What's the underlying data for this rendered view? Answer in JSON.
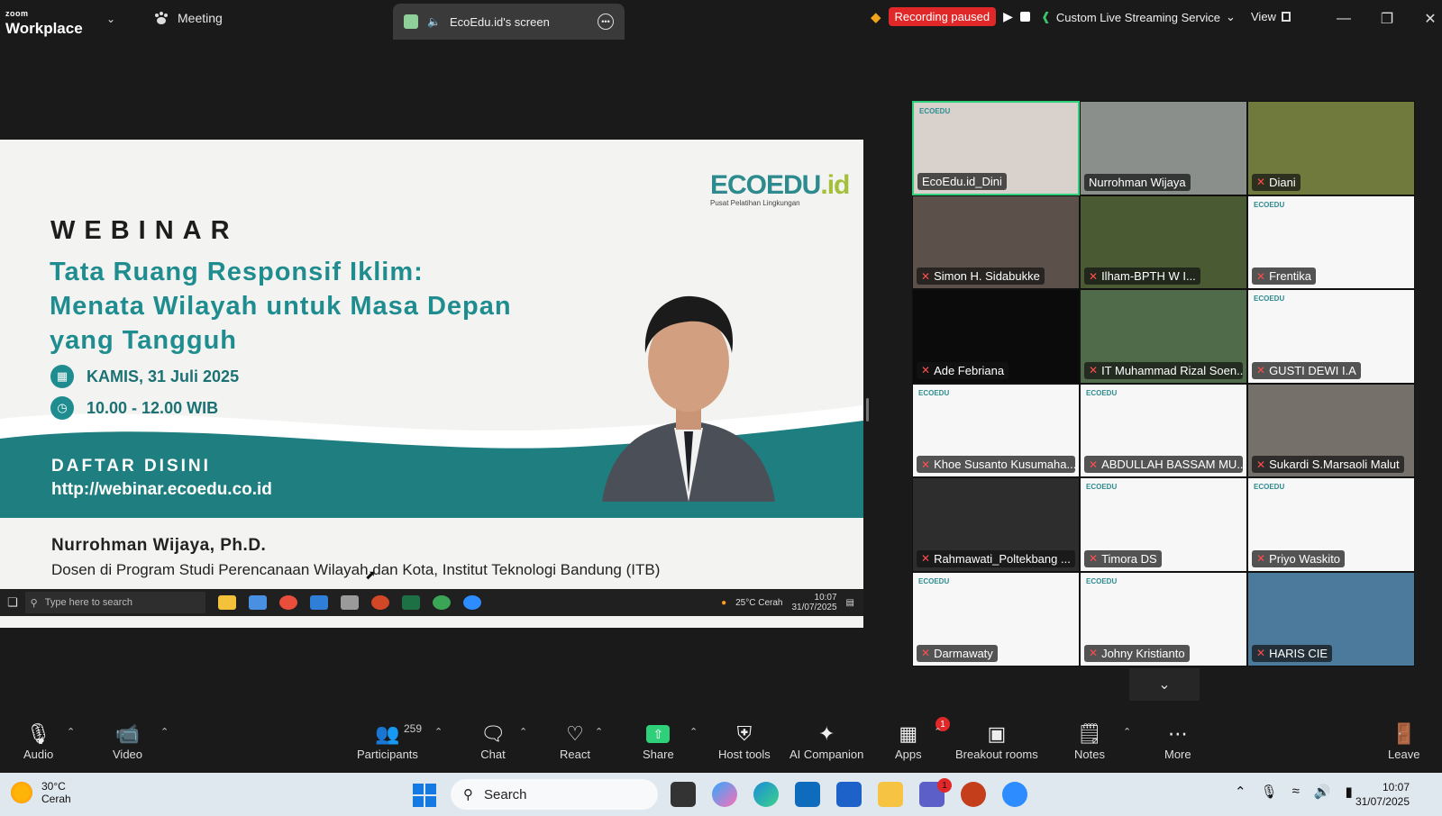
{
  "topbar": {
    "logo_small": "zoom",
    "logo_big": "Workplace",
    "meeting_label": "Meeting",
    "share_tab_title": "EcoEdu.id's screen",
    "recording_status": "Recording paused",
    "stream_label": "Custom Live Streaming Service",
    "view_label": "View"
  },
  "slide": {
    "brand": "ECOEDU",
    "brand_suffix": ".id",
    "brand_sub": "Pusat Pelatihan Lingkungan",
    "kicker": "WEBINAR",
    "title_lines": [
      "Tata Ruang Responsif Iklim:",
      "Menata Wilayah untuk Masa Depan",
      "yang Tangguh"
    ],
    "date": "KAMIS, 31 Juli 2025",
    "time": "10.00 - 12.00 WIB",
    "register_label": "DAFTAR DISINI",
    "register_url": "http://webinar.ecoedu.co.id",
    "speaker_name": "Nurrohman Wijaya, Ph.D.",
    "speaker_role": "Dosen di Program Studi Perencanaan Wilayah dan Kota, Institut Teknologi Bandung (ITB)"
  },
  "shared_taskbar": {
    "search_placeholder": "Type here to search",
    "weather": "25°C Cerah",
    "time": "10:07",
    "date": "31/07/2025"
  },
  "gallery": [
    {
      "name": "EcoEdu.id_Dini",
      "muted": false,
      "bg": "#d9d2cc",
      "active": true
    },
    {
      "name": "Nurrohman Wijaya",
      "muted": false,
      "bg": "#8a8f8c"
    },
    {
      "name": "Diani",
      "muted": true,
      "bg": "#6f7a3c"
    },
    {
      "name": "Simon H. Sidabukke",
      "muted": true,
      "bg": "#5b504a"
    },
    {
      "name": "Ilham-BPTH W I...",
      "muted": true,
      "bg": "#4a5a33"
    },
    {
      "name": "Frentika",
      "muted": true,
      "bg": "white"
    },
    {
      "name": "Ade Febriana",
      "muted": true,
      "bg": "black"
    },
    {
      "name": "IT Muhammad Rizal Soen...",
      "muted": true,
      "bg": "#4f6b4a"
    },
    {
      "name": "GUSTI DEWI I.A",
      "muted": true,
      "bg": "white"
    },
    {
      "name": "Khoe Susanto Kusumaha...",
      "muted": true,
      "bg": "white"
    },
    {
      "name": "ABDULLAH BASSAM MU...",
      "muted": true,
      "bg": "white"
    },
    {
      "name": "Sukardi S.Marsaoli Malut",
      "muted": true,
      "bg": "#75706a"
    },
    {
      "name": "Rahmawati_Poltekbang ...",
      "muted": true,
      "bg": "#2d2d2d"
    },
    {
      "name": "Timora DS",
      "muted": true,
      "bg": "white"
    },
    {
      "name": "Priyo Waskito",
      "muted": true,
      "bg": "white"
    },
    {
      "name": "Darmawaty",
      "muted": true,
      "bg": "white"
    },
    {
      "name": "Johny Kristianto",
      "muted": true,
      "bg": "white"
    },
    {
      "name": "HARIS CIE",
      "muted": true,
      "bg": "#4b7a9c"
    }
  ],
  "gallery_mini_logo": "ECOEDU",
  "toolbar": {
    "audio": "Audio",
    "video": "Video",
    "participants": "Participants",
    "participants_count": "259",
    "chat": "Chat",
    "react": "React",
    "share": "Share",
    "host_tools": "Host tools",
    "ai_companion": "AI Companion",
    "apps": "Apps",
    "apps_badge": "1",
    "breakout": "Breakout rooms",
    "notes": "Notes",
    "more": "More",
    "leave": "Leave"
  },
  "windows": {
    "temp": "30°C",
    "condition": "Cerah",
    "search": "Search",
    "time": "10:07",
    "date": "31/07/2025",
    "teams_badge": "1"
  }
}
